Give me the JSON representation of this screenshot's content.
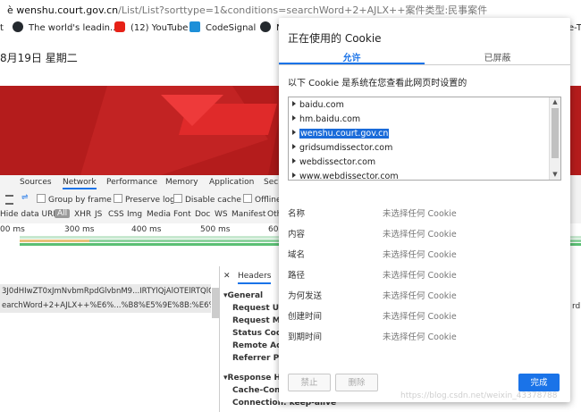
{
  "browser": {
    "url_prefix": "è",
    "url_host": "wenshu.court.gov.cn",
    "url_path": "/List/List?sorttype=1&conditions=searchWord+2+AJLX++案件类型:民事案件",
    "bookmarks": [
      "t",
      "The world's leadin...",
      "(12) YouTube",
      "CodeSignal",
      "N",
      "e-T"
    ]
  },
  "page": {
    "date": "8月19日 星期二"
  },
  "devtools": {
    "tabs": [
      "Sources",
      "Network",
      "Performance",
      "Memory",
      "Application",
      "Secu"
    ],
    "toolbar": {
      "group_by_frame": "Group by frame",
      "preserve_log": "Preserve log",
      "disable_cache": "Disable cache",
      "offline": "Offline"
    },
    "filter": {
      "hide_data_urls": "Hide data URLs",
      "types": [
        "All",
        "XHR",
        "JS",
        "CSS",
        "Img",
        "Media",
        "Font",
        "Doc",
        "WS",
        "Manifest",
        "Oth"
      ]
    },
    "timeline_labels": [
      "00 ms",
      "300 ms",
      "400 ms",
      "500 ms",
      "60"
    ],
    "requests": [
      "3J0dHIwZT0xJmNvbmRpdGlvbnM9...IRTYlQjAlOTElRTQlQkEl",
      "earchWord+2+AJLX++%E6%...%B8%E5%9E%8B:%E6%B0%9"
    ],
    "detail": {
      "tab": "Headers",
      "general": "General",
      "fields": [
        "Request URL",
        "Request Met",
        "Status Code",
        "Remote Add",
        "Referrer Poli"
      ],
      "response": "Response Hea",
      "cache_control": "Cache-Contr",
      "connection": "Connection: keep-alive",
      "side": "rd"
    }
  },
  "dialog": {
    "title": "正在使用的 Cookie",
    "tab_allowed": "允许",
    "tab_blocked": "已屏蔽",
    "description": "以下 Cookie 是系统在您查看此网页时设置的",
    "domains": [
      "baidu.com",
      "hm.baidu.com",
      "wenshu.court.gov.cn",
      "gridsumdissector.com",
      "webdissector.com",
      "www.webdissector.com"
    ],
    "selected_index": 2,
    "fields": [
      {
        "label": "名称",
        "value": "未选择任何 Cookie"
      },
      {
        "label": "内容",
        "value": "未选择任何 Cookie"
      },
      {
        "label": "域名",
        "value": "未选择任何 Cookie"
      },
      {
        "label": "路径",
        "value": "未选择任何 Cookie"
      },
      {
        "label": "为何发送",
        "value": "未选择任何 Cookie"
      },
      {
        "label": "创建时间",
        "value": "未选择任何 Cookie"
      },
      {
        "label": "到期时间",
        "value": "未选择任何 Cookie"
      }
    ],
    "block_button": "禁止",
    "delete_button": "删除",
    "done_button": "完成"
  },
  "watermark": "https://blog.csdn.net/weixin_43378788",
  "colors": {
    "accent": "#1a73e8",
    "banner": "#b41c1c"
  }
}
